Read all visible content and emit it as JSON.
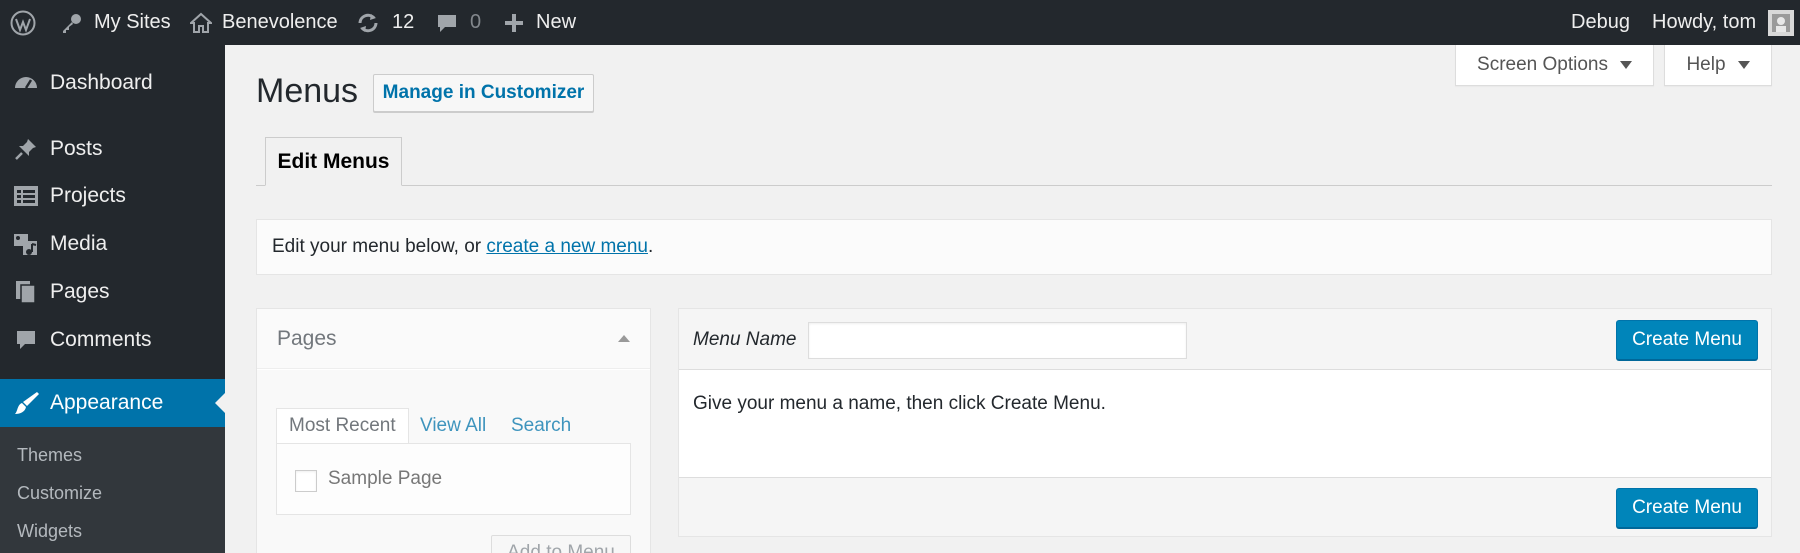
{
  "adminbar": {
    "wp_logo_icon": "wordpress-logo-icon",
    "my_sites": "My Sites",
    "site_name": "Benevolence",
    "updates_count": "12",
    "comments_count": "0",
    "new_label": "New",
    "debug": "Debug",
    "howdy": "Howdy, tom"
  },
  "sidebar": {
    "items": [
      {
        "label": "Dashboard",
        "icon": "dashboard-icon"
      },
      {
        "label": "Posts",
        "icon": "pushpin-icon"
      },
      {
        "label": "Projects",
        "icon": "portfolio-icon"
      },
      {
        "label": "Media",
        "icon": "media-icon"
      },
      {
        "label": "Pages",
        "icon": "pages-icon"
      },
      {
        "label": "Comments",
        "icon": "comment-icon"
      },
      {
        "label": "Appearance",
        "icon": "paintbrush-icon",
        "current": true
      }
    ],
    "submenu": [
      "Themes",
      "Customize",
      "Widgets"
    ]
  },
  "screen_meta": {
    "screen_options": "Screen Options",
    "help": "Help"
  },
  "header": {
    "title": "Menus",
    "manage_button": "Manage in Customizer"
  },
  "tabs": {
    "edit_menus": "Edit Menus"
  },
  "notice": {
    "prefix": "Edit your menu below, or ",
    "link": "create a new menu",
    "suffix": "."
  },
  "pages_box": {
    "title": "Pages",
    "tabs": [
      "Most Recent",
      "View All",
      "Search"
    ],
    "items": [
      "Sample Page"
    ],
    "add_button": "Add to Menu"
  },
  "menu_panel": {
    "name_label": "Menu Name",
    "name_value": "",
    "create_button": "Create Menu",
    "instructions": "Give your menu a name, then click Create Menu."
  },
  "colors": {
    "admin_bar": "#23282d",
    "accent": "#0073aa",
    "primary_button": "#0085ba"
  }
}
